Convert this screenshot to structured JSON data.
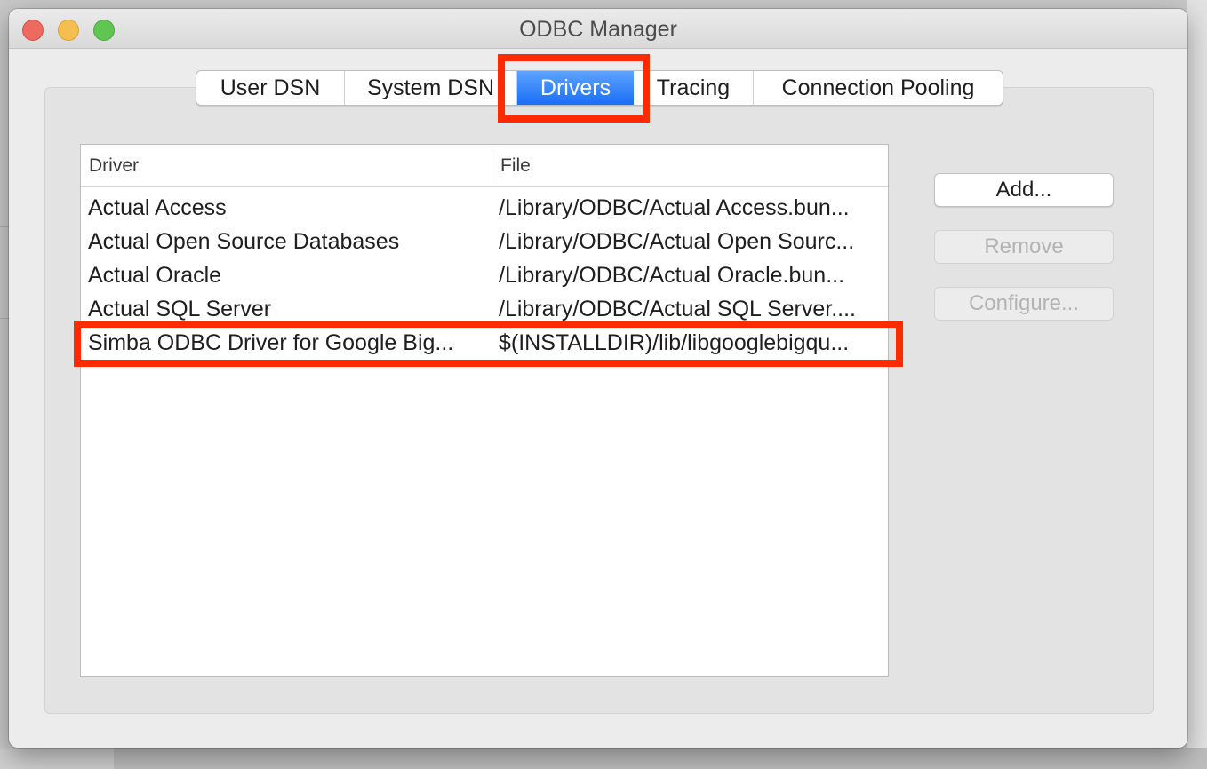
{
  "window": {
    "title": "ODBC Manager"
  },
  "tabs": [
    {
      "label": "User DSN",
      "active": false
    },
    {
      "label": "System DSN",
      "active": false
    },
    {
      "label": "Drivers",
      "active": true
    },
    {
      "label": "Tracing",
      "active": false
    },
    {
      "label": "Connection Pooling",
      "active": false
    }
  ],
  "table": {
    "columns": [
      "Driver",
      "File"
    ],
    "rows": [
      {
        "driver": "Actual Access",
        "file": "/Library/ODBC/Actual Access.bun..."
      },
      {
        "driver": "Actual Open Source Databases",
        "file": "/Library/ODBC/Actual Open Sourc..."
      },
      {
        "driver": "Actual Oracle",
        "file": "/Library/ODBC/Actual Oracle.bun..."
      },
      {
        "driver": "Actual SQL Server",
        "file": "/Library/ODBC/Actual SQL Server...."
      },
      {
        "driver": "Simba ODBC Driver for Google Big...",
        "file": "$(INSTALLDIR)/lib/libgooglebigqu..."
      }
    ]
  },
  "buttons": {
    "add": "Add...",
    "remove": "Remove",
    "configure": "Configure..."
  },
  "colors": {
    "highlight": "#ff2a00",
    "accent": "#1a6ef5"
  }
}
